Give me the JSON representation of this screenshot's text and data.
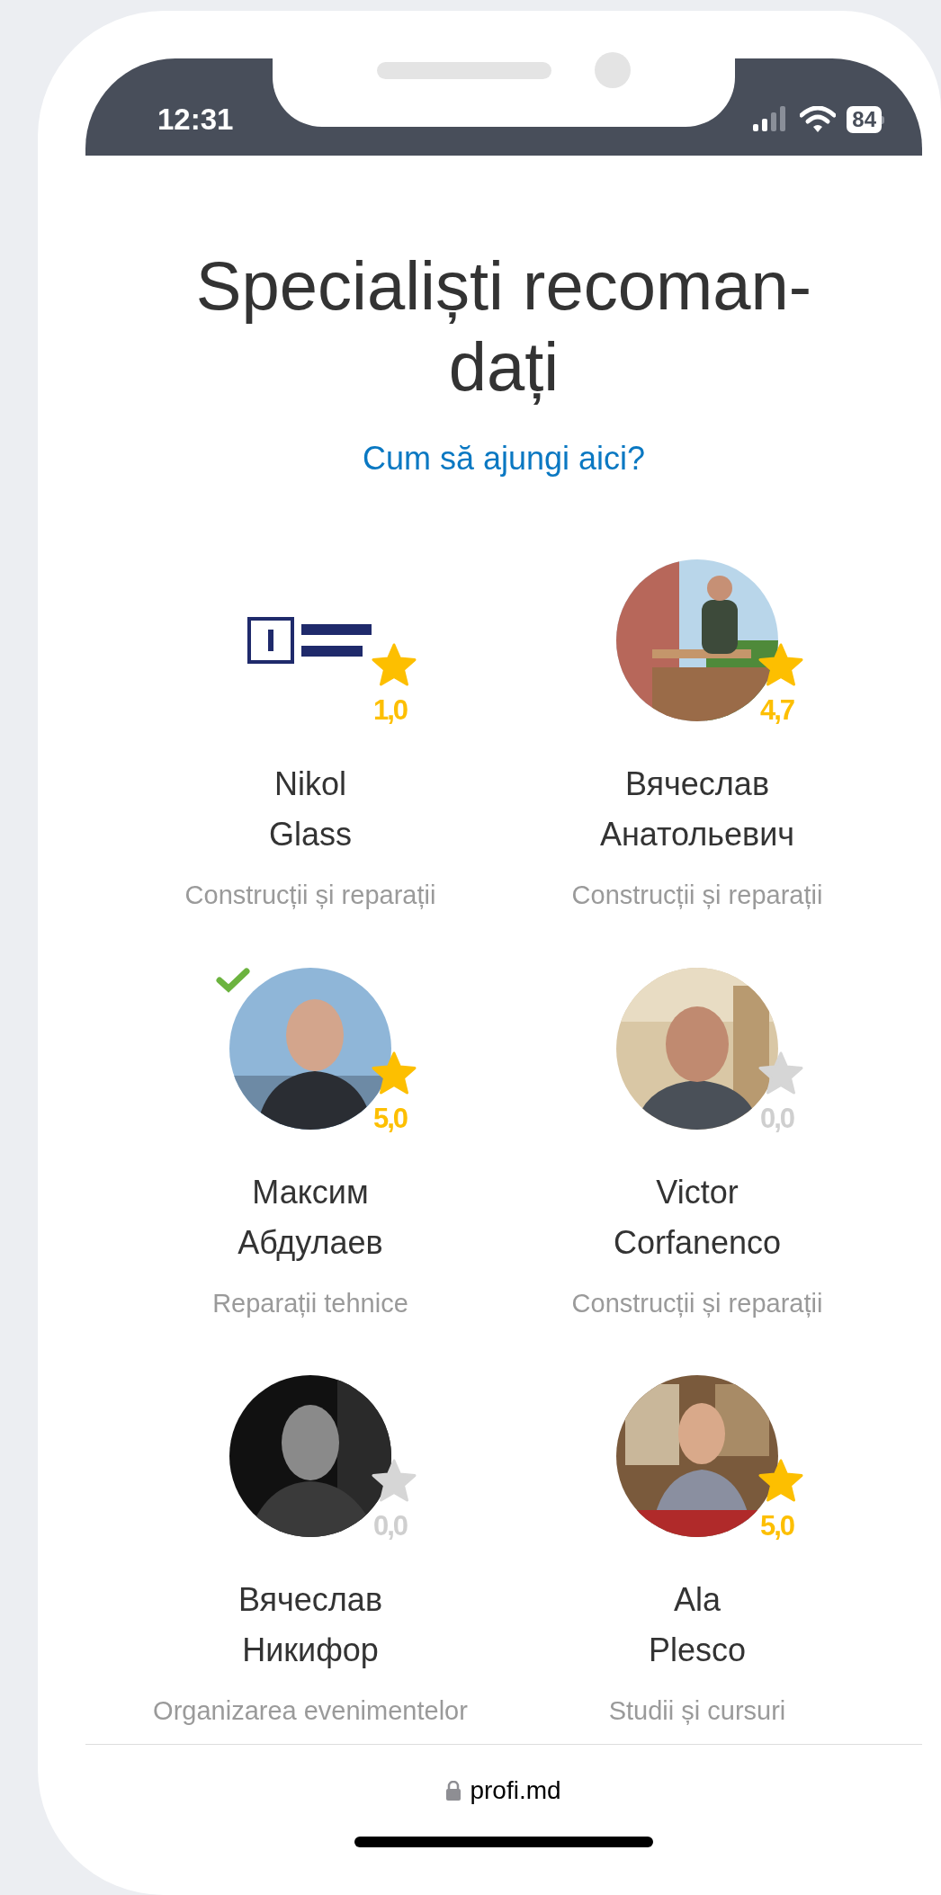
{
  "status_bar": {
    "time": "12:31",
    "battery": "84"
  },
  "title_lines": [
    "Specialiști recoman-",
    "dați"
  ],
  "help_link": "Cum să ajungi aici?",
  "specialists": [
    {
      "name_lines": [
        "Nikol",
        "Glass"
      ],
      "rating": "1,0",
      "star_filled": true,
      "verified": false,
      "category": "Construcții și reparații"
    },
    {
      "name_lines": [
        "Вячеслав",
        "Анатольевич"
      ],
      "rating": "4,7",
      "star_filled": true,
      "verified": false,
      "category": "Construcții și reparații"
    },
    {
      "name_lines": [
        "Максим",
        "Абдулаев"
      ],
      "rating": "5,0",
      "star_filled": true,
      "verified": true,
      "category": "Reparații tehnice"
    },
    {
      "name_lines": [
        "Victor",
        "Corfanenco"
      ],
      "rating": "0,0",
      "star_filled": false,
      "verified": false,
      "category": "Construcții și reparații"
    },
    {
      "name_lines": [
        "Вячеслав",
        "Никифор"
      ],
      "rating": "0,0",
      "star_filled": false,
      "verified": false,
      "category": "Organizarea evenimentelor"
    },
    {
      "name_lines": [
        "Ala",
        "Plesco"
      ],
      "rating": "5,0",
      "star_filled": true,
      "verified": false,
      "category": "Studii și cursuri"
    }
  ],
  "address_bar": {
    "url": "profi.md"
  }
}
